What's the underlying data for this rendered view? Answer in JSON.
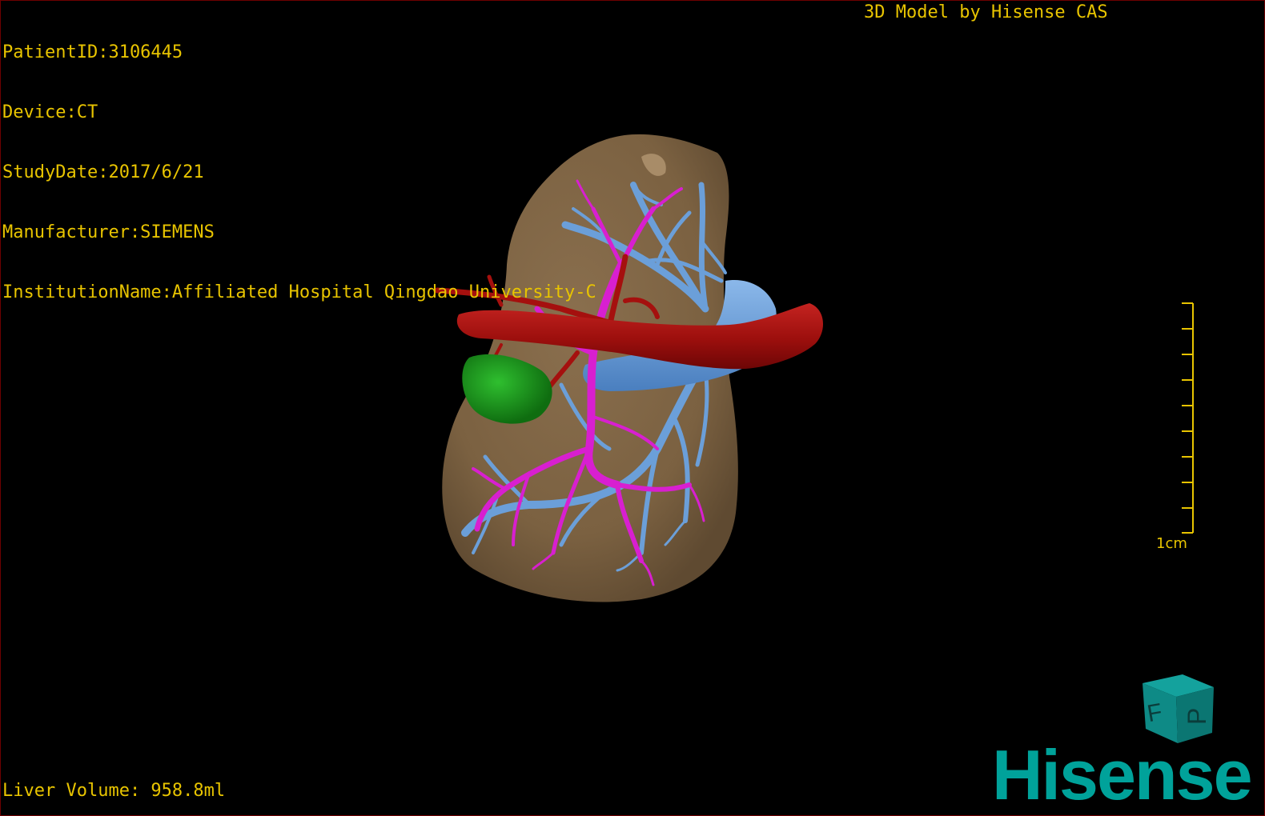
{
  "info": {
    "patient_id": "PatientID:3106445",
    "device": "Device:CT",
    "study_date": "StudyDate:2017/6/21",
    "manufacturer": "Manufacturer:SIEMENS",
    "institution": "InstitutionName:Affiliated Hospital Qingdao University-C"
  },
  "model_credit": "3D Model by Hisense CAS",
  "liver_volume": "Liver Volume: 958.8ml",
  "scale_bar": {
    "label": "1cm",
    "color": "#e8c400"
  },
  "orientation_cube": {
    "faces": [
      "P",
      "F"
    ],
    "color": "#0e8a86"
  },
  "brand": {
    "name": "Hisense",
    "color": "#00a29a"
  },
  "colors": {
    "text": "#e8c400",
    "liver": "#7b6141",
    "artery": "#a5100e",
    "portal_vein": "#d81fd0",
    "hepatic_vein": "#6b9fd9",
    "gallbladder": "#1b9a1b"
  }
}
